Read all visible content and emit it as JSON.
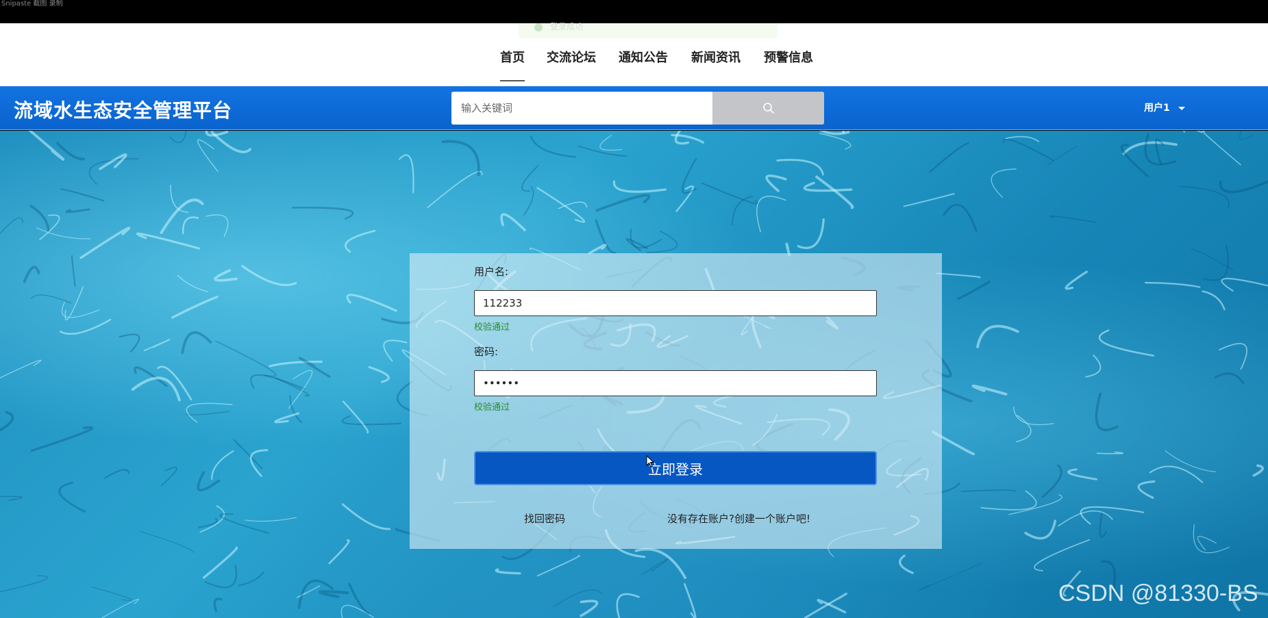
{
  "top_bar": {
    "caption": "Snipaste 截图 录制"
  },
  "toast": {
    "text": "登录成功"
  },
  "nav": {
    "items": [
      {
        "label": "首页",
        "active": true
      },
      {
        "label": "交流论坛",
        "active": false
      },
      {
        "label": "通知公告",
        "active": false
      },
      {
        "label": "新闻资讯",
        "active": false
      },
      {
        "label": "预警信息",
        "active": false
      }
    ]
  },
  "header": {
    "site_title": "流域水生态安全管理平台",
    "search_placeholder": "输入关键词",
    "search_icon": "search-icon",
    "user_label": "用户1"
  },
  "login": {
    "username_label": "用户名:",
    "username_value": "112233",
    "username_status": "校验通过",
    "password_label": "密码:",
    "password_value": "123456",
    "password_status": "校验通过",
    "submit_label": "立即登录",
    "forgot_link": "找回密码",
    "register_link": "没有存在账户?创建一个账户吧!"
  },
  "watermark": "CSDN @81330-BS",
  "colors": {
    "header_blue": "#0a63cf",
    "button_blue": "#0757c3",
    "valid_green": "#2e8b2e"
  }
}
